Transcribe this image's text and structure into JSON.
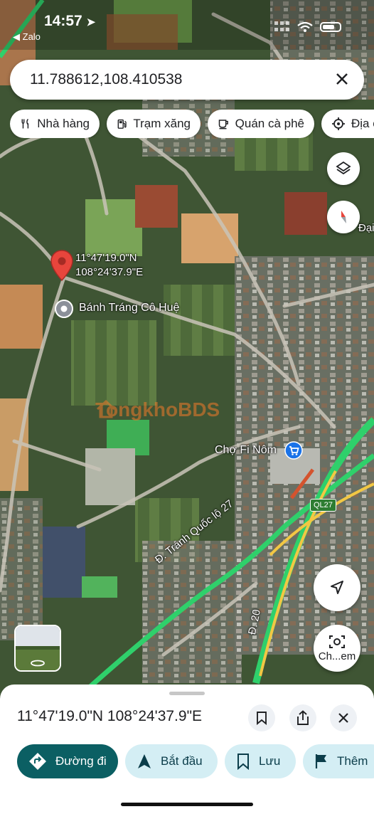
{
  "status_bar": {
    "time": "14:57",
    "back_app": "Zalo"
  },
  "search": {
    "value": "11.788612,108.410538"
  },
  "categories": [
    {
      "label": "Nhà hàng",
      "icon": "restaurant-icon"
    },
    {
      "label": "Trạm xăng",
      "icon": "gas-station-icon"
    },
    {
      "label": "Quán cà phê",
      "icon": "coffee-icon"
    },
    {
      "label": "Địa c",
      "icon": "attraction-icon"
    }
  ],
  "map": {
    "pin_label_line1": "11°47'19.0\"N",
    "pin_label_line2": "108°24'37.9\"E",
    "place_label": "Bánh Tráng Cô Huệ",
    "market_label": "Chợ Fi Nôm",
    "watermark": "TongkhoBDS",
    "road_badge": "QL27",
    "road_name": "Đ. Tránh Quốc lộ 27",
    "road_20": "Đ. 20",
    "compass_side_label": "Đại",
    "street_view_label": "Ch...em",
    "colors": {
      "route": "#2fd06b",
      "route_core": "#f2c744",
      "pin": "#e8453c"
    }
  },
  "sheet": {
    "title": "11°47'19.0\"N 108°24'37.9\"E",
    "actions": [
      {
        "label": "Đường đi",
        "icon": "directions-icon"
      },
      {
        "label": "Bắt đầu",
        "icon": "navigation-arrow-icon"
      },
      {
        "label": "Lưu",
        "icon": "bookmark-icon"
      },
      {
        "label": "Thêm",
        "icon": "flag-icon"
      }
    ]
  }
}
